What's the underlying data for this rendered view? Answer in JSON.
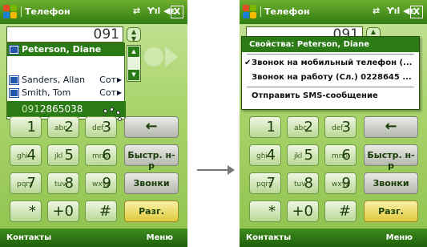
{
  "title": "Телефон",
  "close": "X",
  "entry_value": "091",
  "list": [
    {
      "name": "Peterson, Diane",
      "type": "",
      "selected": true
    },
    {
      "name": "Sanders, Allan",
      "type": "Сот",
      "selected": false
    },
    {
      "name": "Smith, Tom",
      "type": "Сот",
      "selected": false
    }
  ],
  "selected_number": {
    "hl": "091",
    "rest": "2865038"
  },
  "keys": [
    {
      "digit": "1",
      "letters": ""
    },
    {
      "digit": "2",
      "letters": "abc"
    },
    {
      "digit": "3",
      "letters": "def"
    },
    {
      "digit": "4",
      "letters": "ghi"
    },
    {
      "digit": "5",
      "letters": "jkl"
    },
    {
      "digit": "6",
      "letters": "mno"
    },
    {
      "digit": "7",
      "letters": "pqrs"
    },
    {
      "digit": "8",
      "letters": "tuv"
    },
    {
      "digit": "9",
      "letters": "wxyz"
    },
    {
      "digit": "*",
      "letters": ""
    },
    {
      "digit": "+0",
      "letters": ""
    },
    {
      "digit": "#",
      "letters": ""
    }
  ],
  "side_keys": {
    "backspace": "←",
    "speed": "Быстр. н-р",
    "calllog": "Звонки",
    "talk": "Разг."
  },
  "softkeys": {
    "left": "Контакты",
    "right": "Меню"
  },
  "menu": {
    "title": "Свойства: Peterson, Diane",
    "items": [
      "Звонок на мобильный телефон (...",
      "Звонок на работу (Сл.) 0228645 ...",
      "Отправить SMS-сообщение"
    ]
  },
  "colors": {
    "brand": "#2a7a16",
    "talk": "#e0c93c"
  }
}
